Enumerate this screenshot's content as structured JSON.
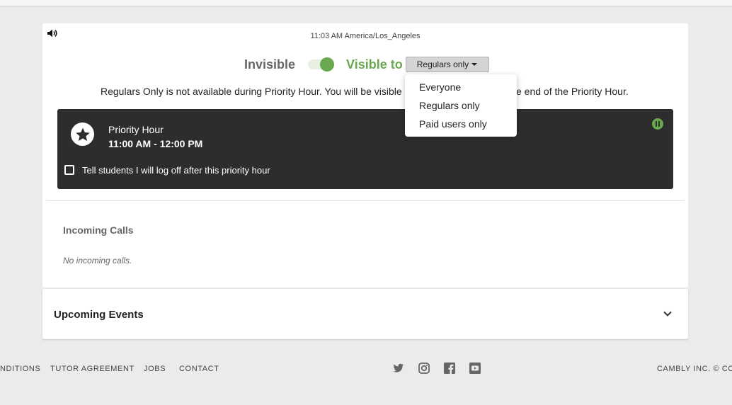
{
  "status_card": {
    "time": "11:03 AM America/Los_Angeles",
    "invisible_label": "Invisible",
    "visible_label": "Visible to",
    "visibility_selected": "Regulars only",
    "notice_before": "Regulars Only is not available during Priority Hour. You will be visible",
    "notice_after": "e end of the Priority Hour."
  },
  "priority_hour": {
    "title": "Priority Hour",
    "time_range": "11:00 AM - 12:00 PM",
    "logoff_label": "Tell students I will log off after this priority hour"
  },
  "incoming_calls": {
    "title": "Incoming Calls",
    "empty_text": "No incoming calls."
  },
  "upcoming_events": {
    "title": "Upcoming Events"
  },
  "visibility_menu": {
    "options": [
      "Everyone",
      "Regulars only",
      "Paid users only"
    ]
  },
  "footer": {
    "links": [
      "NDITIONS",
      "TUTOR AGREEMENT",
      "JOBS",
      "CONTACT"
    ],
    "copyright": "CAMBLY INC. © CO",
    "social_icons": [
      "twitter-icon",
      "instagram-icon",
      "facebook-icon",
      "youtube-icon"
    ]
  },
  "colors": {
    "accent_green": "#6aa84f",
    "dark_panel": "#2d2d2d",
    "page_background": "#ebebeb"
  }
}
